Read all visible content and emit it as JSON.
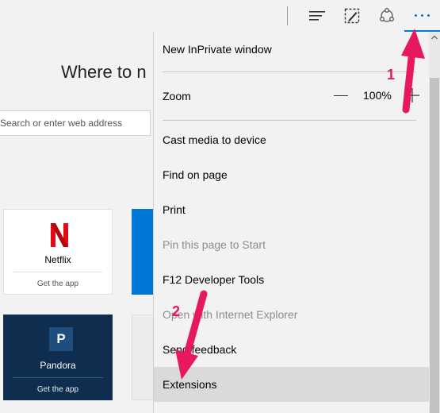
{
  "toolbar": {
    "icons": [
      "hub-icon",
      "web-note-icon",
      "share-icon",
      "more-actions-icon"
    ]
  },
  "page": {
    "heading": "Where to n",
    "search_placeholder": "Search or enter web address"
  },
  "tiles": [
    {
      "name": "Netflix",
      "logo": "N",
      "cta": "Get the app"
    },
    {
      "name": "Pandora",
      "logo": "P",
      "cta": "Get the app"
    }
  ],
  "menu": {
    "new_inprivate": "New InPrivate window",
    "zoom_label": "Zoom",
    "zoom_value": "100%",
    "cast": "Cast media to device",
    "find": "Find on page",
    "print": "Print",
    "pin": "Pin this page to Start",
    "devtools": "F12 Developer Tools",
    "open_ie": "Open with Internet Explorer",
    "feedback": "Send feedback",
    "extensions": "Extensions"
  },
  "annotations": {
    "step1": "1",
    "step2": "2",
    "color": "#e8185f"
  }
}
